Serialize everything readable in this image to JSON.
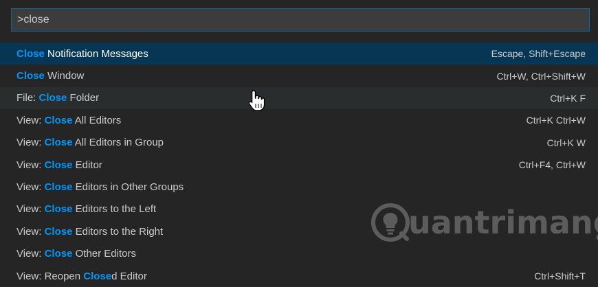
{
  "search": {
    "value": ">close"
  },
  "commands": [
    {
      "prefix": "",
      "highlight": "Close",
      "suffix": " Notification Messages",
      "keybinding": "Escape, Shift+Escape",
      "state": "selected"
    },
    {
      "prefix": "",
      "highlight": "Close",
      "suffix": " Window",
      "keybinding": "Ctrl+W, Ctrl+Shift+W",
      "state": ""
    },
    {
      "prefix": "File: ",
      "highlight": "Close",
      "suffix": " Folder",
      "keybinding": "Ctrl+K F",
      "state": "hover"
    },
    {
      "prefix": "View: ",
      "highlight": "Close",
      "suffix": " All Editors",
      "keybinding": "Ctrl+K Ctrl+W",
      "state": ""
    },
    {
      "prefix": "View: ",
      "highlight": "Close",
      "suffix": " All Editors in Group",
      "keybinding": "Ctrl+K W",
      "state": ""
    },
    {
      "prefix": "View: ",
      "highlight": "Close",
      "suffix": " Editor",
      "keybinding": "Ctrl+F4, Ctrl+W",
      "state": ""
    },
    {
      "prefix": "View: ",
      "highlight": "Close",
      "suffix": " Editors in Other Groups",
      "keybinding": "",
      "state": ""
    },
    {
      "prefix": "View: ",
      "highlight": "Close",
      "suffix": " Editors to the Left",
      "keybinding": "",
      "state": ""
    },
    {
      "prefix": "View: ",
      "highlight": "Close",
      "suffix": " Editors to the Right",
      "keybinding": "",
      "state": ""
    },
    {
      "prefix": "View: ",
      "highlight": "Close",
      "suffix": " Other Editors",
      "keybinding": "",
      "state": ""
    },
    {
      "prefix": "View: Reopen ",
      "highlight": "Close",
      "suffix": "d Editor",
      "keybinding": "Ctrl+Shift+T",
      "state": ""
    }
  ],
  "watermark": {
    "text": "uantrimang"
  },
  "colors": {
    "highlight": "#0097fb",
    "selected_bg": "#073655",
    "hover_bg": "#2a2d2e",
    "input_border": "#0e639c"
  },
  "icons": {
    "cursor": "hand-pointer-icon",
    "watermark_logo": "lightbulb-logo-icon"
  }
}
